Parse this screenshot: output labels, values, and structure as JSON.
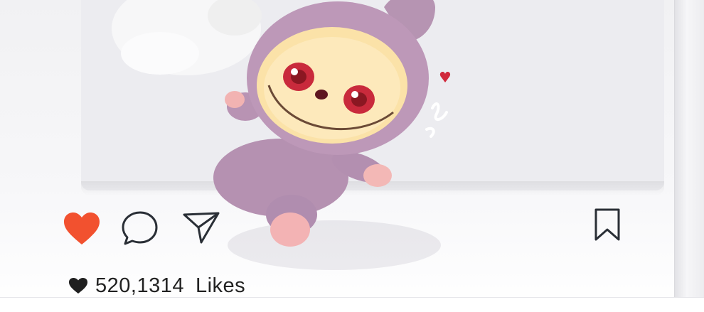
{
  "post": {
    "image": {
      "subject": "plush-toy-figure",
      "doodle_heart_color": "#d0283b"
    },
    "actions": {
      "like": {
        "icon": "heart-filled-icon",
        "color": "#f2512f"
      },
      "comment": {
        "icon": "comment-bubble-icon"
      },
      "share": {
        "icon": "paper-plane-icon"
      },
      "save": {
        "icon": "bookmark-icon"
      }
    },
    "likes": {
      "icon": "heart-small-icon",
      "count": "520,1314",
      "label": "Likes"
    }
  }
}
